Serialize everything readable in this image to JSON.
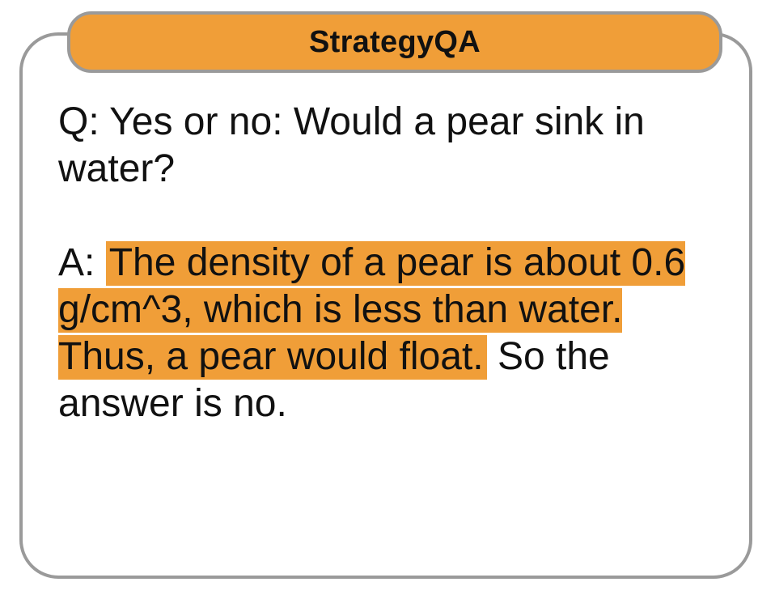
{
  "title": "StrategyQA",
  "question": "Q: Yes or no: Would a pear sink in water?",
  "answer": {
    "prefix": "A: ",
    "highlighted": "The density of a pear is about 0.6 g/cm^3, which is less than water. Thus, a pear would float.",
    "rest": " So the answer is no."
  },
  "colors": {
    "highlight": "#f09e38",
    "border": "#9a9a9a",
    "text": "#111111"
  }
}
